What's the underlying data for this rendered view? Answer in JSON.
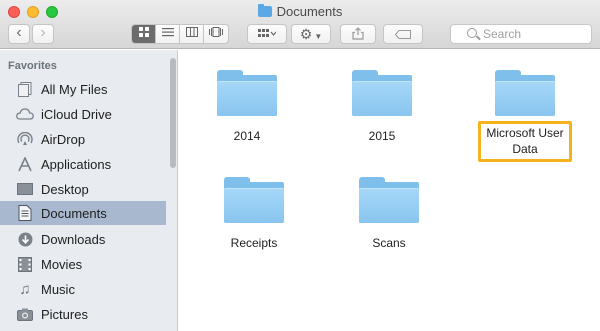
{
  "window": {
    "title": "Documents"
  },
  "toolbar": {
    "back_glyph": "‹",
    "forward_glyph": "›",
    "search_placeholder": "Search"
  },
  "sidebar": {
    "heading": "Favorites",
    "items": [
      {
        "label": "All My Files",
        "icon": "all-files-icon"
      },
      {
        "label": "iCloud Drive",
        "icon": "cloud-icon"
      },
      {
        "label": "AirDrop",
        "icon": "airdrop-icon"
      },
      {
        "label": "Applications",
        "icon": "applications-icon"
      },
      {
        "label": "Desktop",
        "icon": "desktop-icon"
      },
      {
        "label": "Documents",
        "icon": "document-icon",
        "selected": true
      },
      {
        "label": "Downloads",
        "icon": "download-icon"
      },
      {
        "label": "Movies",
        "icon": "movies-icon"
      },
      {
        "label": "Music",
        "icon": "music-icon"
      },
      {
        "label": "Pictures",
        "icon": "camera-icon"
      }
    ]
  },
  "folders": [
    {
      "name": "2014"
    },
    {
      "name": "2015"
    },
    {
      "name": "Microsoft User Data",
      "highlighted": true
    },
    {
      "name": "Receipts"
    },
    {
      "name": "Scans"
    }
  ],
  "colors": {
    "sidebar_selected": "#a8b9cf",
    "folder_blue": "#89c5ef",
    "highlight": "#f5b21a"
  }
}
